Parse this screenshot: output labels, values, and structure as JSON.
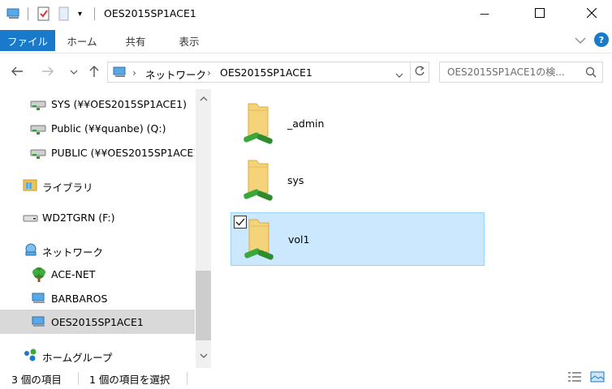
{
  "window": {
    "title": "OES2015SP1ACE1",
    "minimize_glyph": "—",
    "maximize_glyph": "☐",
    "close_glyph": "✕"
  },
  "ribbon": {
    "tabs": [
      {
        "label": "ファイル"
      },
      {
        "label": "ホーム"
      },
      {
        "label": "共有"
      },
      {
        "label": "表示"
      }
    ]
  },
  "address": {
    "breadcrumb": [
      "ネットワーク",
      "OES2015SP1ACE1"
    ]
  },
  "search": {
    "placeholder": "OES2015SP1ACE1の検..."
  },
  "nav_pane": {
    "items": [
      {
        "label": "SYS (¥¥OES2015SP1ACE1)",
        "icon": "network-drive-icon"
      },
      {
        "label": "Public (¥¥quanbe) (Q:)",
        "icon": "network-drive-icon"
      },
      {
        "label": "PUBLIC (¥¥OES2015SP1ACE1",
        "icon": "network-drive-icon"
      },
      {
        "label": "ライブラリ",
        "icon": "library-icon"
      },
      {
        "label": "WD2TGRN (F:)",
        "icon": "drive-icon"
      },
      {
        "label": "ネットワーク",
        "icon": "network-icon"
      },
      {
        "label": "ACE-NET",
        "icon": "tree-icon"
      },
      {
        "label": "BARBAROS",
        "icon": "computer-icon"
      },
      {
        "label": "OES2015SP1ACE1",
        "icon": "computer-icon",
        "selected": true
      },
      {
        "label": "ホームグループ",
        "icon": "homegroup-icon"
      }
    ]
  },
  "content": {
    "items": [
      {
        "name": "_admin",
        "selected": false
      },
      {
        "name": "sys",
        "selected": false
      },
      {
        "name": "vol1",
        "selected": true
      }
    ]
  },
  "status": {
    "item_count": "3 個の項目",
    "selected_count": "1 個の項目を選択"
  },
  "colors": {
    "file_tab": "#1979ca",
    "selection": "#cce8ff",
    "selection_border": "#99d1ff",
    "nav_selected": "#d9d9d9",
    "folder": "#f5d37a",
    "share_pipe": "#3aa83a"
  }
}
